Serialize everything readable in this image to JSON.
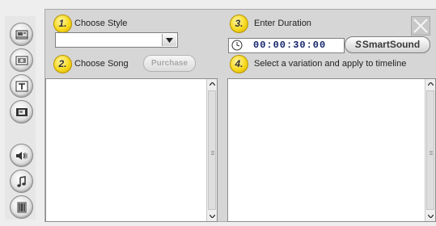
{
  "steps": {
    "step1": {
      "number": "1.",
      "label": "Choose Style"
    },
    "step2": {
      "number": "2.",
      "label": "Choose Song"
    },
    "step3": {
      "number": "3.",
      "label": "Enter Duration"
    },
    "step4": {
      "number": "4.",
      "label": "Select a variation and apply to timeline"
    }
  },
  "style_select": {
    "value": ""
  },
  "purchase_button": {
    "label": "Purchase",
    "enabled": false
  },
  "duration": {
    "timecode": "00:00:30:00"
  },
  "smartsound_button": {
    "mark": "S",
    "label": "SmartSound"
  },
  "sidebar": {
    "tools": [
      {
        "icon": "video-capture-icon"
      },
      {
        "icon": "photo-icon"
      },
      {
        "icon": "title-text-icon"
      },
      {
        "icon": "film-overlay-icon"
      },
      {
        "icon": "audio-speaker-icon"
      },
      {
        "icon": "music-note-icon"
      },
      {
        "icon": "film-reel-icon"
      }
    ]
  },
  "colors": {
    "badge": "#f6d91c",
    "timecode_text": "#13236b",
    "panel_bg": "#d6d6d6"
  }
}
